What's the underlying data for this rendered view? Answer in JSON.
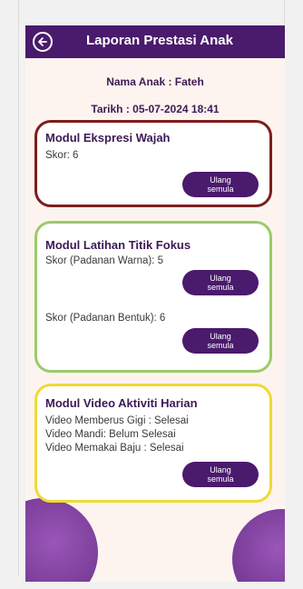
{
  "app_bar": {
    "title": "Laporan Prestasi Anak",
    "back_icon": "back-arrow-icon"
  },
  "meta": {
    "child_name": "Nama Anak : Fateh",
    "date": "Tarikh : 05-07-2024 18:41"
  },
  "cards": [
    {
      "title": "Modul Ekspresi Wajah",
      "border_color": "#7d1d1d",
      "lines": [
        "Skor: 6"
      ],
      "buttons": [
        "Ulang\nsemula"
      ]
    },
    {
      "title": "Modul Latihan Titik Fokus",
      "border_color": "#9acb6a",
      "lines": [
        "Skor (Padanan Warna): 5",
        "Skor (Padanan Bentuk): 6"
      ],
      "buttons": [
        "Ulang\nsemula",
        "Ulang\nsemula"
      ]
    },
    {
      "title": "Modul Video Aktiviti Harian",
      "border_color": "#f0d934",
      "lines": [
        "Video Memberus Gigi : Selesai",
        "Video Mandi: Belum Selesai",
        "Video Memakai Baju : Selesai"
      ],
      "buttons": [
        "Ulang\nsemula"
      ]
    }
  ],
  "colors": {
    "primary": "#4a1a6c",
    "background": "#fdf4f0"
  }
}
